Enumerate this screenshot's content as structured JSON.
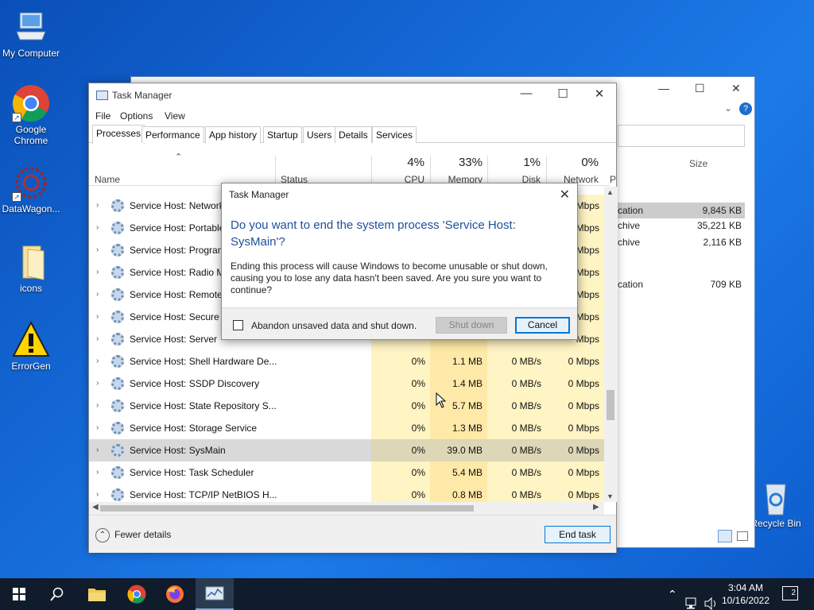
{
  "desktop": {
    "icons": [
      {
        "label": "My Computer"
      },
      {
        "label": "Google Chrome"
      },
      {
        "label": "DataWagon..."
      },
      {
        "label": "icons"
      },
      {
        "label": "ErrorGen"
      },
      {
        "label": "Recycle Bin"
      }
    ]
  },
  "explorer_bg": {
    "size_header": "Size",
    "rows": [
      {
        "type": "cation",
        "size": "9,845 KB"
      },
      {
        "type": "chive",
        "size": "35,221 KB"
      },
      {
        "type": "chive",
        "size": "2,116 KB"
      },
      {
        "type": "cation",
        "size": "709 KB"
      }
    ]
  },
  "task_manager": {
    "title": "Task Manager",
    "menu": [
      "File",
      "Options",
      "View"
    ],
    "tabs": [
      "Processes",
      "Performance",
      "App history",
      "Startup",
      "Users",
      "Details",
      "Services"
    ],
    "columns": {
      "name": "Name",
      "status": "Status",
      "cpu": {
        "pct": "4%",
        "label": "CPU"
      },
      "memory": {
        "pct": "33%",
        "label": "Memory"
      },
      "disk": {
        "pct": "1%",
        "label": "Disk"
      },
      "network": {
        "pct": "0%",
        "label": "Network"
      },
      "power": "P"
    },
    "rows": [
      {
        "name": "Service Host: Network",
        "cpu": "",
        "mem": "",
        "disk": "",
        "net": "Mbps"
      },
      {
        "name": "Service Host: Portable",
        "cpu": "",
        "mem": "",
        "disk": "",
        "net": "Mbps"
      },
      {
        "name": "Service Host: Program",
        "cpu": "",
        "mem": "",
        "disk": "",
        "net": "Mbps"
      },
      {
        "name": "Service Host: Radio M",
        "cpu": "",
        "mem": "",
        "disk": "",
        "net": "Mbps"
      },
      {
        "name": "Service Host: Remote",
        "cpu": "",
        "mem": "",
        "disk": "",
        "net": "Mbps"
      },
      {
        "name": "Service Host: Secure S",
        "cpu": "",
        "mem": "",
        "disk": "",
        "net": "Mbps"
      },
      {
        "name": "Service Host: Server",
        "cpu": "",
        "mem": "",
        "disk": "",
        "net": "Mbps"
      },
      {
        "name": "Service Host: Shell Hardware De...",
        "cpu": "0%",
        "mem": "1.1 MB",
        "disk": "0 MB/s",
        "net": "0 Mbps"
      },
      {
        "name": "Service Host: SSDP Discovery",
        "cpu": "0%",
        "mem": "1.4 MB",
        "disk": "0 MB/s",
        "net": "0 Mbps"
      },
      {
        "name": "Service Host: State Repository S...",
        "cpu": "0%",
        "mem": "5.7 MB",
        "disk": "0 MB/s",
        "net": "0 Mbps"
      },
      {
        "name": "Service Host: Storage Service",
        "cpu": "0%",
        "mem": "1.3 MB",
        "disk": "0 MB/s",
        "net": "0 Mbps"
      },
      {
        "name": "Service Host: SysMain",
        "cpu": "0%",
        "mem": "39.0 MB",
        "disk": "0 MB/s",
        "net": "0 Mbps"
      },
      {
        "name": "Service Host: Task Scheduler",
        "cpu": "0%",
        "mem": "5.4 MB",
        "disk": "0 MB/s",
        "net": "0 Mbps"
      },
      {
        "name": "Service Host: TCP/IP NetBIOS H...",
        "cpu": "0%",
        "mem": "0.8 MB",
        "disk": "0 MB/s",
        "net": "0 Mbps"
      }
    ],
    "fewer_details": "Fewer details",
    "end_task": "End task"
  },
  "dialog": {
    "title": "Task Manager",
    "question": "Do you want to end the system process 'Service Host: SysMain'?",
    "body": "Ending this process will cause Windows to become unusable or shut down, causing you to lose any data hasn't been saved. Are you sure you want to continue?",
    "checkbox_label": "Abandon unsaved data and shut down.",
    "shutdown": "Shut down",
    "cancel": "Cancel"
  },
  "taskbar": {
    "time": "3:04 AM",
    "date": "10/16/2022",
    "notifications": "2"
  }
}
